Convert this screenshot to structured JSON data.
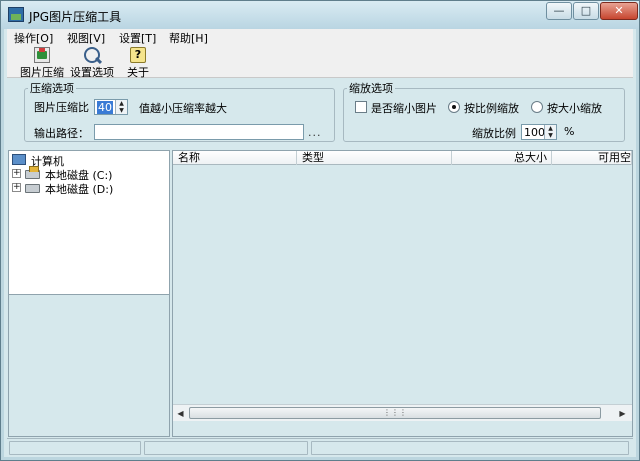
{
  "window": {
    "title": "JPG图片压缩工具"
  },
  "menu": [
    "操作[O]",
    "视图[V]",
    "设置[T]",
    "帮助[H]"
  ],
  "toolbar": {
    "compress_label": "图片压缩",
    "settings_label": "设置选项",
    "about_label": "关于"
  },
  "compress_options": {
    "legend": "压缩选项",
    "ratio_label": "图片压缩比",
    "ratio_value": "40",
    "hint": "值越小压缩率越大",
    "output_label": "输出路径：",
    "output_value": "",
    "browse": "..."
  },
  "scale_options": {
    "legend": "缩放选项",
    "shrink_label": "是否缩小图片",
    "shrink_checked": false,
    "by_ratio_label": "按比例缩放",
    "by_size_label": "按大小缩放",
    "selected_mode": "by_ratio",
    "ratio_label": "缩放比例",
    "ratio_value": "100",
    "unit": "%"
  },
  "tree": {
    "root": "计算机",
    "drives": [
      "本地磁盘 (C:)",
      "本地磁盘 (D:)"
    ]
  },
  "list": {
    "columns": [
      "名称",
      "类型",
      "总大小",
      "可用空"
    ]
  },
  "icons": {
    "app": "image-app-icon",
    "compress": "image-compress-icon",
    "settings": "magnifier-settings-icon",
    "about": "question-note-icon"
  }
}
